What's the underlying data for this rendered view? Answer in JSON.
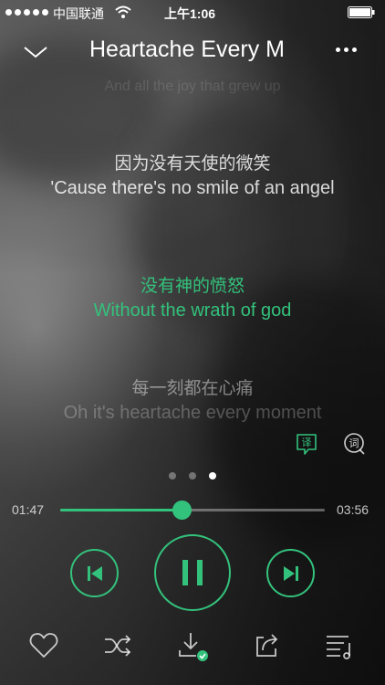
{
  "status_bar": {
    "carrier": "中国联通",
    "time": "上午1:06"
  },
  "header": {
    "title": "Heartache Every M",
    "back_icon": "chevron-down-icon",
    "more_icon": "more-dots-icon"
  },
  "lyrics": {
    "faint_previous": "And all the joy that grew up",
    "lines": [
      {
        "zh": "因为没有天使的微笑",
        "en": "'Cause there's no smile of an angel",
        "state": "past"
      },
      {
        "zh": "没有神的愤怒",
        "en": "Without the wrath of god",
        "state": "current"
      },
      {
        "zh": "每一刻都在心痛",
        "en": "Oh it's heartache every moment",
        "state": "next"
      }
    ],
    "tools": {
      "translate_label": "译",
      "lyrics_label": "词"
    }
  },
  "pager": {
    "count": 3,
    "active_index": 2
  },
  "progress": {
    "current": "01:47",
    "total": "03:56",
    "fraction": 0.46
  },
  "controls": {
    "prev_icon": "skip-previous-icon",
    "pause_icon": "pause-icon",
    "next_icon": "skip-next-icon"
  },
  "bottom_bar": [
    {
      "name": "favorite",
      "icon": "heart-icon"
    },
    {
      "name": "shuffle",
      "icon": "shuffle-icon"
    },
    {
      "name": "download",
      "icon": "download-done-icon"
    },
    {
      "name": "share",
      "icon": "share-icon"
    },
    {
      "name": "playlist",
      "icon": "playlist-icon"
    }
  ],
  "colors": {
    "accent": "#33c27c",
    "text": "#ffffff"
  }
}
